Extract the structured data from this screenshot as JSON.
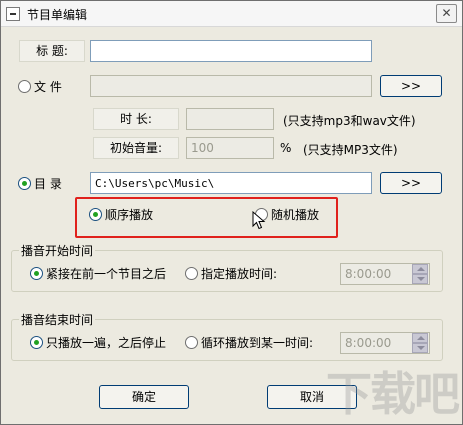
{
  "window": {
    "title": "节目单编辑",
    "close_glyph": "✕"
  },
  "form": {
    "title_label": "标  题:",
    "title_value": "",
    "file_label": "文  件",
    "file_value": "",
    "file_browse": ">>",
    "duration_label": "时  长:",
    "duration_value": "",
    "duration_hint": "(只支持mp3和wav文件)",
    "volume_label": "初始音量:",
    "volume_value": "100",
    "volume_unit": "%",
    "volume_hint": "(只支持MP3文件)",
    "dir_label": "目  录",
    "dir_value": "C:\\Users\\pc\\Music\\",
    "dir_browse": ">>",
    "order_sequential": "顺序播放",
    "order_random": "随机播放"
  },
  "start_group": {
    "title": "播音开始时间",
    "after_previous": "紧接在前一个节目之后",
    "specified_time": "指定播放时间:",
    "time_value": "8:00:00"
  },
  "end_group": {
    "title": "播音结束时间",
    "play_once": "只播放一遍，之后停止",
    "loop_until": "循环播放到某一时间:",
    "time_value": "8:00:00"
  },
  "buttons": {
    "ok": "确定",
    "cancel": "取消"
  },
  "watermark": "下载吧"
}
